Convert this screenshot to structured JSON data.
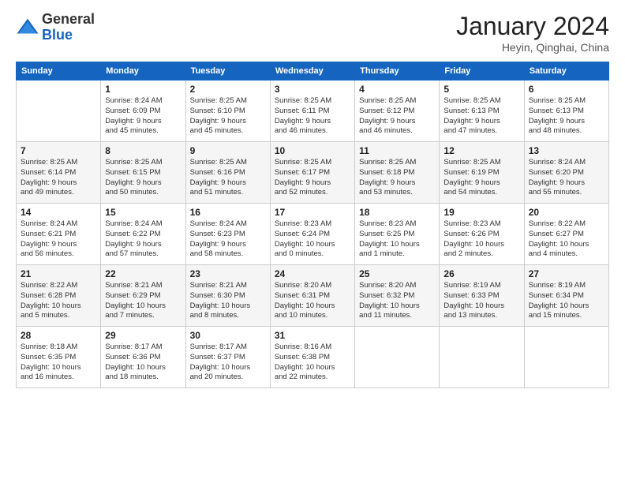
{
  "header": {
    "logo_line1": "General",
    "logo_line2": "Blue",
    "month": "January 2024",
    "location": "Heyin, Qinghai, China"
  },
  "days_of_week": [
    "Sunday",
    "Monday",
    "Tuesday",
    "Wednesday",
    "Thursday",
    "Friday",
    "Saturday"
  ],
  "weeks": [
    [
      {
        "day": "",
        "info": ""
      },
      {
        "day": "1",
        "info": "Sunrise: 8:24 AM\nSunset: 6:09 PM\nDaylight: 9 hours\nand 45 minutes."
      },
      {
        "day": "2",
        "info": "Sunrise: 8:25 AM\nSunset: 6:10 PM\nDaylight: 9 hours\nand 45 minutes."
      },
      {
        "day": "3",
        "info": "Sunrise: 8:25 AM\nSunset: 6:11 PM\nDaylight: 9 hours\nand 46 minutes."
      },
      {
        "day": "4",
        "info": "Sunrise: 8:25 AM\nSunset: 6:12 PM\nDaylight: 9 hours\nand 46 minutes."
      },
      {
        "day": "5",
        "info": "Sunrise: 8:25 AM\nSunset: 6:13 PM\nDaylight: 9 hours\nand 47 minutes."
      },
      {
        "day": "6",
        "info": "Sunrise: 8:25 AM\nSunset: 6:13 PM\nDaylight: 9 hours\nand 48 minutes."
      }
    ],
    [
      {
        "day": "7",
        "info": "Sunrise: 8:25 AM\nSunset: 6:14 PM\nDaylight: 9 hours\nand 49 minutes."
      },
      {
        "day": "8",
        "info": "Sunrise: 8:25 AM\nSunset: 6:15 PM\nDaylight: 9 hours\nand 50 minutes."
      },
      {
        "day": "9",
        "info": "Sunrise: 8:25 AM\nSunset: 6:16 PM\nDaylight: 9 hours\nand 51 minutes."
      },
      {
        "day": "10",
        "info": "Sunrise: 8:25 AM\nSunset: 6:17 PM\nDaylight: 9 hours\nand 52 minutes."
      },
      {
        "day": "11",
        "info": "Sunrise: 8:25 AM\nSunset: 6:18 PM\nDaylight: 9 hours\nand 53 minutes."
      },
      {
        "day": "12",
        "info": "Sunrise: 8:25 AM\nSunset: 6:19 PM\nDaylight: 9 hours\nand 54 minutes."
      },
      {
        "day": "13",
        "info": "Sunrise: 8:24 AM\nSunset: 6:20 PM\nDaylight: 9 hours\nand 55 minutes."
      }
    ],
    [
      {
        "day": "14",
        "info": "Sunrise: 8:24 AM\nSunset: 6:21 PM\nDaylight: 9 hours\nand 56 minutes."
      },
      {
        "day": "15",
        "info": "Sunrise: 8:24 AM\nSunset: 6:22 PM\nDaylight: 9 hours\nand 57 minutes."
      },
      {
        "day": "16",
        "info": "Sunrise: 8:24 AM\nSunset: 6:23 PM\nDaylight: 9 hours\nand 58 minutes."
      },
      {
        "day": "17",
        "info": "Sunrise: 8:23 AM\nSunset: 6:24 PM\nDaylight: 10 hours\nand 0 minutes."
      },
      {
        "day": "18",
        "info": "Sunrise: 8:23 AM\nSunset: 6:25 PM\nDaylight: 10 hours\nand 1 minute."
      },
      {
        "day": "19",
        "info": "Sunrise: 8:23 AM\nSunset: 6:26 PM\nDaylight: 10 hours\nand 2 minutes."
      },
      {
        "day": "20",
        "info": "Sunrise: 8:22 AM\nSunset: 6:27 PM\nDaylight: 10 hours\nand 4 minutes."
      }
    ],
    [
      {
        "day": "21",
        "info": "Sunrise: 8:22 AM\nSunset: 6:28 PM\nDaylight: 10 hours\nand 5 minutes."
      },
      {
        "day": "22",
        "info": "Sunrise: 8:21 AM\nSunset: 6:29 PM\nDaylight: 10 hours\nand 7 minutes."
      },
      {
        "day": "23",
        "info": "Sunrise: 8:21 AM\nSunset: 6:30 PM\nDaylight: 10 hours\nand 8 minutes."
      },
      {
        "day": "24",
        "info": "Sunrise: 8:20 AM\nSunset: 6:31 PM\nDaylight: 10 hours\nand 10 minutes."
      },
      {
        "day": "25",
        "info": "Sunrise: 8:20 AM\nSunset: 6:32 PM\nDaylight: 10 hours\nand 11 minutes."
      },
      {
        "day": "26",
        "info": "Sunrise: 8:19 AM\nSunset: 6:33 PM\nDaylight: 10 hours\nand 13 minutes."
      },
      {
        "day": "27",
        "info": "Sunrise: 8:19 AM\nSunset: 6:34 PM\nDaylight: 10 hours\nand 15 minutes."
      }
    ],
    [
      {
        "day": "28",
        "info": "Sunrise: 8:18 AM\nSunset: 6:35 PM\nDaylight: 10 hours\nand 16 minutes."
      },
      {
        "day": "29",
        "info": "Sunrise: 8:17 AM\nSunset: 6:36 PM\nDaylight: 10 hours\nand 18 minutes."
      },
      {
        "day": "30",
        "info": "Sunrise: 8:17 AM\nSunset: 6:37 PM\nDaylight: 10 hours\nand 20 minutes."
      },
      {
        "day": "31",
        "info": "Sunrise: 8:16 AM\nSunset: 6:38 PM\nDaylight: 10 hours\nand 22 minutes."
      },
      {
        "day": "",
        "info": ""
      },
      {
        "day": "",
        "info": ""
      },
      {
        "day": "",
        "info": ""
      }
    ]
  ]
}
